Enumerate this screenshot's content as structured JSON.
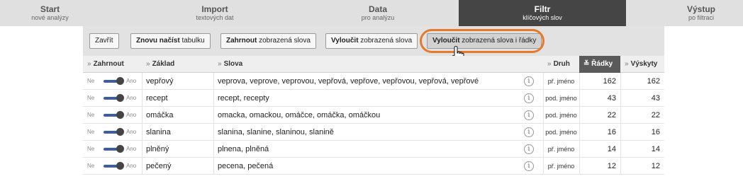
{
  "nav": [
    {
      "title": "Start",
      "subtitle": "nové analýzy",
      "active": false
    },
    {
      "title": "Import",
      "subtitle": "textových dat",
      "active": false
    },
    {
      "title": "Data",
      "subtitle": "pro analýzu",
      "active": false
    },
    {
      "title": "Filtr",
      "subtitle": "klíčových slov",
      "active": true
    },
    {
      "title": "Výstup",
      "subtitle": "po filtraci",
      "active": false
    }
  ],
  "toolbar": {
    "close": "Zavřít",
    "reload_bold": "Znovu načíst",
    "reload_rest": " tabulku",
    "include_bold": "Zahrnout",
    "include_rest": " zobrazená slova",
    "exclude_bold": "Vyloučit",
    "exclude_rest": " zobrazená slova",
    "exclude_rows_bold": "Vyloučit",
    "exclude_rows_rest": " zobrazená slova i řádky"
  },
  "table": {
    "sort_marker": "»",
    "sorted_marker": "≚",
    "headers": {
      "include": "Zahrnout",
      "base": "Základ",
      "words": "Slova",
      "type": "Druh",
      "rows": "Řádky",
      "occurrences": "Výskyty"
    },
    "toggle_off": "Ne",
    "toggle_on": "Ano",
    "info_glyph": "i",
    "rows": [
      {
        "base": "vepřový",
        "words": "veprova, veprove, veprovou, vepřová, vepřove, vepřovou, vepřová, vepřové",
        "type": "př. jméno",
        "rows": "162",
        "occurrences": "162"
      },
      {
        "base": "recept",
        "words": "recept, recepty",
        "type": "pod. jméno",
        "rows": "43",
        "occurrences": "43"
      },
      {
        "base": "omáčka",
        "words": "omacka, omackou, omáčce, omáčka, omáčkou",
        "type": "pod. jméno",
        "rows": "22",
        "occurrences": "22"
      },
      {
        "base": "slanina",
        "words": "slanina, slanine, slaninou, slanině",
        "type": "pod. jméno",
        "rows": "16",
        "occurrences": "16"
      },
      {
        "base": "plněný",
        "words": "plnena, plněná",
        "type": "př. jméno",
        "rows": "14",
        "occurrences": "14"
      },
      {
        "base": "pečený",
        "words": "pecena, pečená",
        "type": "př. jméno",
        "rows": "12",
        "occurrences": "12"
      }
    ]
  },
  "colors": {
    "highlight": "#e8792a",
    "toggle": "#3d5da8",
    "active_tab": "#454545"
  }
}
